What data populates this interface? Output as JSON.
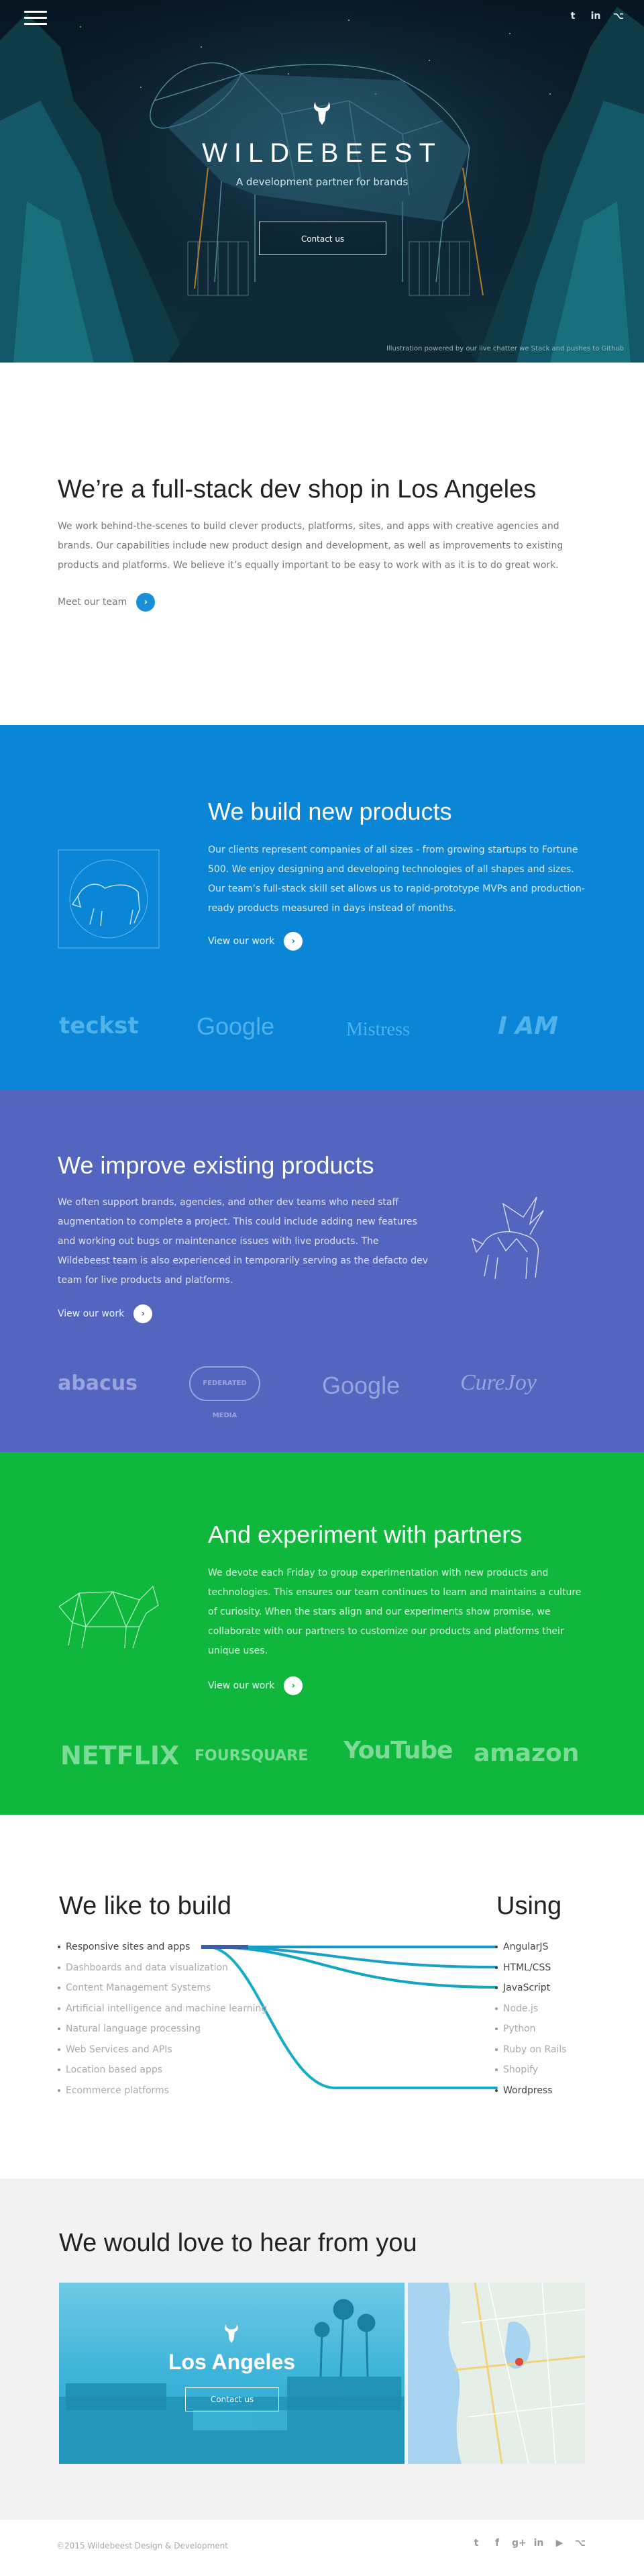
{
  "hero": {
    "title": "WILDEBEEST",
    "subtitle": "A development partner for brands",
    "contact_button": "Contact us",
    "credit": "Illustration powered by our live chatter we Stack and pushes to Github",
    "social": [
      "twitter-icon",
      "linkedin-icon",
      "github-icon"
    ]
  },
  "intro": {
    "title": "We’re a full-stack dev shop in Los Angeles",
    "text": "We work behind-the-scenes to build clever products, platforms, sites, and apps with creative agencies and brands. Our capabilities include new product design and development, as well as improvements to existing products and platforms. We believe it’s equally important to be easy to work with as it is to do great work.",
    "link": "Meet our team",
    "link_arrow": "›"
  },
  "products": {
    "title": "We build new products",
    "text": "Our clients represent companies of all sizes - from growing startups to Fortune 500. We enjoy designing and developing technologies of all shapes and sizes. Our team’s full-stack skill set allows us to rapid-prototype MVPs and production-ready products measured in days instead of months.",
    "link": "View our work",
    "link_arrow": "›",
    "logos": [
      "teckst",
      "Google",
      "Mistress",
      "I AM"
    ],
    "color": "#0b86d6"
  },
  "improve": {
    "title": "We improve existing products",
    "text": "We often support brands, agencies, and other dev teams who need staff augmentation to complete a project. This could include adding new features and working out bugs or maintenance issues with live products. The Wildebeest team is also experienced in temporarily serving as the defacto dev team for live products and platforms.",
    "link": "View our work",
    "link_arrow": "›",
    "logos": [
      "abacus",
      "FEDERATED MEDIA",
      "Google",
      "CureJoy"
    ],
    "color": "#5465c0"
  },
  "experiment": {
    "title": "And experiment with partners",
    "text": "We devote each Friday to group experimentation with new products and technologies. This ensures our team continues to learn and maintains a culture of curiosity. When the stars align and our experiments show promise, we collaborate with our partners to customize our products and platforms  their unique uses.",
    "link": "View our work",
    "link_arrow": "›",
    "logos": [
      "NETFLIX",
      "FOURSQUARE",
      "YouTube",
      "amazon"
    ],
    "color": "#0fb83d"
  },
  "build": {
    "title": "We like to build",
    "items": [
      "Responsive sites and apps",
      "Dashboards and data visualization",
      "Content Management Systems",
      "Artificial intelligence and machine learning",
      "Natural language processing",
      "Web Services and APIs",
      "Location based apps",
      "Ecommerce platforms"
    ]
  },
  "using": {
    "title": "Using",
    "items": [
      "AngularJS",
      "HTML/CSS",
      "JavaScript",
      "Node.js",
      "Python",
      "Ruby on Rails",
      "Shopify",
      "Wordpress"
    ]
  },
  "contact": {
    "title": "We would love to hear from you",
    "city": "Los Angeles",
    "button": "Contact us"
  },
  "footer": {
    "copyright": "©2015 Wildebeest Design & Development",
    "social": [
      "twitter-icon",
      "facebook-icon",
      "google-plus-icon",
      "linkedin-icon",
      "youtube-icon",
      "github-icon"
    ]
  }
}
